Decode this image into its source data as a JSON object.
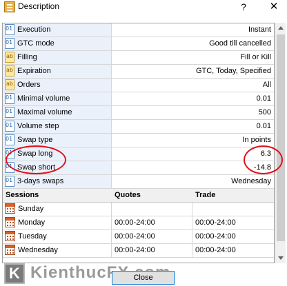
{
  "window": {
    "title": "Description",
    "help_glyph": "?",
    "close_glyph": "✕"
  },
  "properties": [
    {
      "label": "Execution",
      "value": "Instant",
      "icon": "numeric-property-icon"
    },
    {
      "label": "GTC mode",
      "value": "Good till cancelled",
      "icon": "numeric-property-icon"
    },
    {
      "label": "Filling",
      "value": "Fill or Kill",
      "icon": "string-property-icon"
    },
    {
      "label": "Expiration",
      "value": "GTC, Today, Specified",
      "icon": "string-property-icon"
    },
    {
      "label": "Orders",
      "value": "All",
      "icon": "string-property-icon"
    },
    {
      "label": "Minimal volume",
      "value": "0.01",
      "icon": "numeric-property-icon"
    },
    {
      "label": "Maximal volume",
      "value": "500",
      "icon": "numeric-property-icon"
    },
    {
      "label": "Volume step",
      "value": "0.01",
      "icon": "numeric-property-icon"
    },
    {
      "label": "Swap type",
      "value": "In points",
      "icon": "numeric-property-icon"
    },
    {
      "label": "Swap long",
      "value": "6.3",
      "icon": "numeric-property-icon"
    },
    {
      "label": "Swap short",
      "value": "-14.8",
      "icon": "numeric-property-icon"
    },
    {
      "label": "3-days swaps",
      "value": "Wednesday",
      "icon": "numeric-property-icon"
    }
  ],
  "sessions": {
    "headers": {
      "sessions": "Sessions",
      "quotes": "Quotes",
      "trade": "Trade"
    },
    "rows": [
      {
        "day": "Sunday",
        "quotes": "",
        "trade": ""
      },
      {
        "day": "Monday",
        "quotes": "00:00-24:00",
        "trade": "00:00-24:00"
      },
      {
        "day": "Tuesday",
        "quotes": "00:00-24:00",
        "trade": "00:00-24:00"
      },
      {
        "day": "Wednesday",
        "quotes": "00:00-24:00",
        "trade": "00:00-24:00"
      }
    ]
  },
  "watermark": {
    "badge": "K",
    "text": "KienthucFX.com"
  },
  "footer": {
    "close_label": "Close"
  },
  "colors": {
    "highlight": "#e0101a",
    "accent": "#0078d7",
    "name_column": "#eaf1fb"
  }
}
